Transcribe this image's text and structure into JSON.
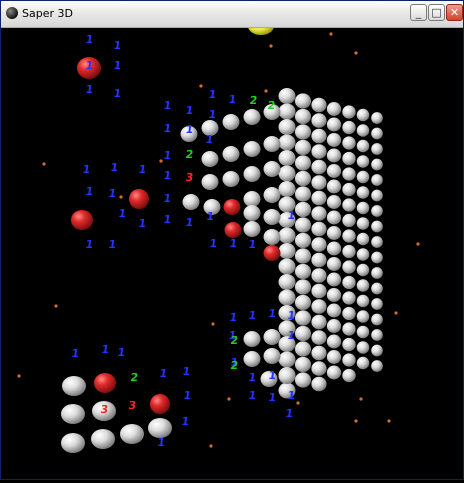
{
  "window": {
    "title": "Saper 3D",
    "buttons": {
      "minimize": "_",
      "maximize": "□",
      "close": "✕"
    }
  },
  "icons": {
    "app": "mine-icon",
    "minimize": "minimize-icon",
    "maximize": "maximize-icon",
    "close": "close-icon"
  },
  "colors": {
    "background": "#000000",
    "unrevealed_cell": "#e6e6e6",
    "mine": "#e02a2a",
    "number_1": "#2233ff",
    "number_2": "#22cc22",
    "number_3": "#ff2222",
    "sun": "#f0f040"
  },
  "board": {
    "number_labels": [
      "1",
      "1",
      "1",
      "1",
      "1",
      "1",
      "1",
      "1",
      "1",
      "1",
      "2",
      "2",
      "1",
      "1",
      "1",
      "1",
      "1",
      "1",
      "2",
      "1",
      "3",
      "1",
      "1",
      "1",
      "1",
      "1",
      "1",
      "1",
      "1",
      "1",
      "1",
      "1",
      "1",
      "1",
      "1",
      "1",
      "1",
      "1",
      "1",
      "1",
      "1",
      "1",
      "1",
      "2",
      "1",
      "1",
      "1",
      "2",
      "1",
      "1",
      "1",
      "1",
      "1",
      "1",
      "1",
      "1",
      "2",
      "1",
      "1",
      "3",
      "3",
      "1",
      "1"
    ]
  }
}
